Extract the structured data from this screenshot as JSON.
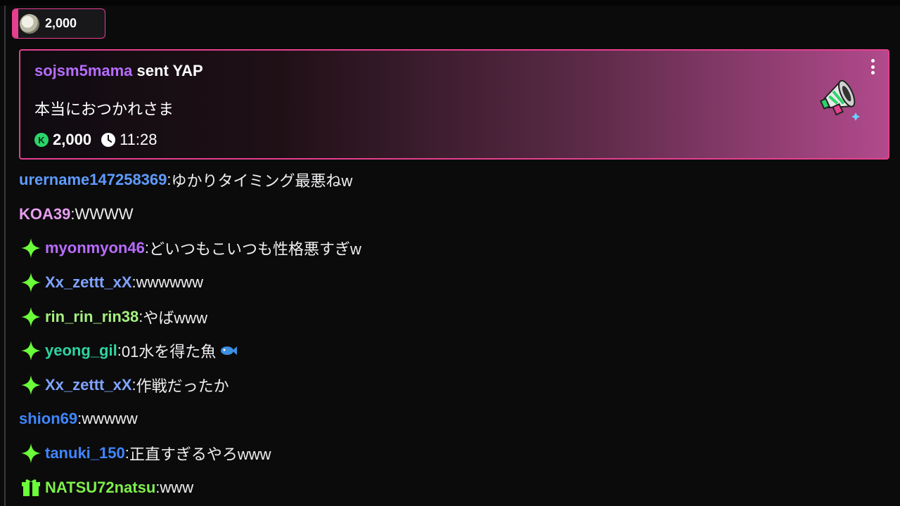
{
  "bits_pill": {
    "amount": "2,000",
    "avatar_icon": "frog-avatar",
    "accent": "#e5408f"
  },
  "yap": {
    "sender": "sojsm5mama",
    "action": " sent YAP",
    "message": "本当におつかれさま",
    "amount": "2,000",
    "time": "11:28",
    "coin_icon": "kick-coin-icon",
    "clock_icon": "clock-icon",
    "menu_icon": "more-vertical-icon",
    "image_icon": "megaphone-icon",
    "colors": {
      "border": "#e5408f",
      "sender": "#b86cff"
    }
  },
  "chat": {
    "messages": [
      {
        "user": "urername147258369",
        "text": "ゆかりタイミング最悪ねw",
        "badge": "",
        "color": "#5f9bff"
      },
      {
        "user": "KOA39",
        "text": "WWWW",
        "badge": "",
        "color": "#e79ef0"
      },
      {
        "user": "myonmyon46",
        "text": "どいつもこいつも性格悪すぎw",
        "badge": "sparkle",
        "color": "#b86cff"
      },
      {
        "user": "Xx_zettt_xX",
        "text": "wwwwww",
        "badge": "sparkle",
        "color": "#7fa3ff"
      },
      {
        "user": "rin_rin_rin38",
        "text": "やばwww",
        "badge": "sparkle",
        "color": "#a6f07f"
      },
      {
        "user": "yeong_gil",
        "text": "01水を得た魚",
        "badge": "sparkle",
        "color": "#2fd3a0",
        "emote": "fish-emote"
      },
      {
        "user": "Xx_zettt_xX",
        "text": "作戦だったか",
        "badge": "sparkle",
        "color": "#7fa3ff"
      },
      {
        "user": "shion69",
        "text": "wwwww",
        "badge": "",
        "color": "#3f86ff"
      },
      {
        "user": "tanuki_150",
        "text": "正直すぎるやろwww",
        "badge": "sparkle",
        "color": "#3f86ff"
      },
      {
        "user": "NATSU72natsu",
        "text": "www",
        "badge": "gift",
        "color": "#7ff04a"
      }
    ]
  }
}
